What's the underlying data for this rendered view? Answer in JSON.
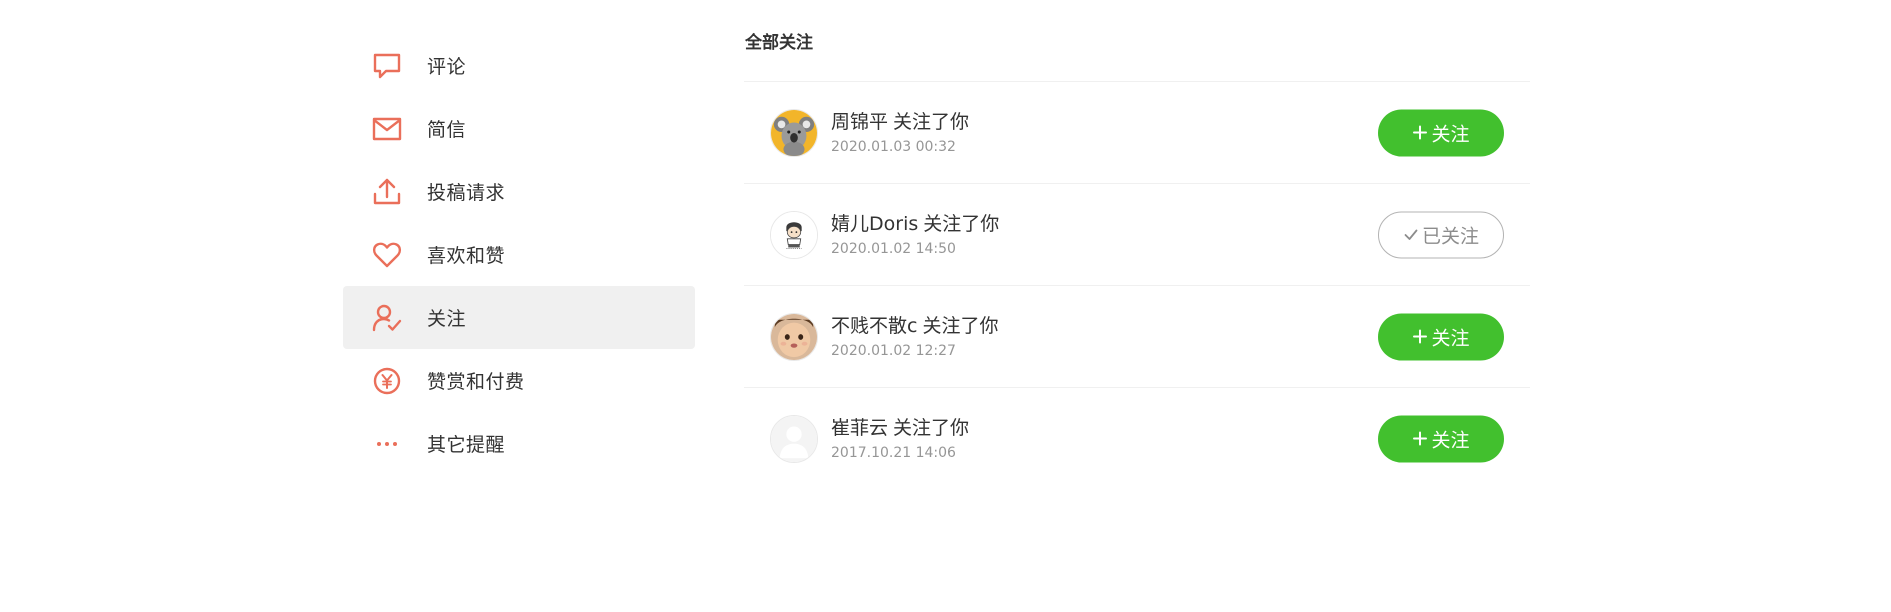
{
  "sidebar": {
    "accent_color": "#ea6f5a",
    "active_background": "#f0f0f0",
    "items": [
      {
        "label": "评论",
        "icon": "comment-icon",
        "active": false
      },
      {
        "label": "简信",
        "icon": "mail-icon",
        "active": false
      },
      {
        "label": "投稿请求",
        "icon": "upload-icon",
        "active": false
      },
      {
        "label": "喜欢和赞",
        "icon": "heart-icon",
        "active": false
      },
      {
        "label": "关注",
        "icon": "user-check-icon",
        "active": true
      },
      {
        "label": "赞赏和付费",
        "icon": "yen-icon",
        "active": false
      },
      {
        "label": "其它提醒",
        "icon": "more-dots-icon",
        "active": false
      }
    ]
  },
  "main": {
    "title": "全部关注",
    "follow_color": "#42c02e",
    "notifications": [
      {
        "user": "周锦平",
        "action": "关注了你",
        "time": "2020.01.03 00:32",
        "avatar": "koala-avatar",
        "button_label": "关注",
        "button_icon": "plus-icon",
        "following": false
      },
      {
        "user": "婧儿Doris",
        "action": "关注了你",
        "time": "2020.01.02 14:50",
        "avatar": "cartoon-avatar",
        "button_label": "已关注",
        "button_icon": "check-icon",
        "following": true
      },
      {
        "user": "不贱不散c",
        "action": "关注了你",
        "time": "2020.01.02 12:27",
        "avatar": "baby-avatar",
        "button_label": "关注",
        "button_icon": "plus-icon",
        "following": false
      },
      {
        "user": "崔菲云",
        "action": "关注了你",
        "time": "2017.10.21 14:06",
        "avatar": "default-avatar",
        "button_label": "关注",
        "button_icon": "plus-icon",
        "following": false
      }
    ]
  }
}
